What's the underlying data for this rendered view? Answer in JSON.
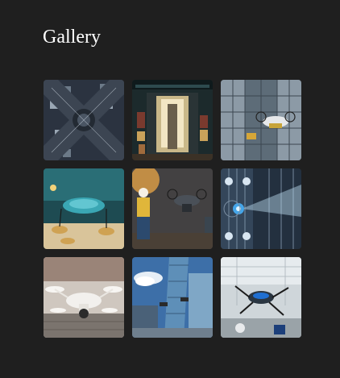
{
  "header": {
    "title": "Gallery"
  },
  "gallery": {
    "images": [
      {
        "subject": "aerial-city-intersection"
      },
      {
        "subject": "storefront-corridor"
      },
      {
        "subject": "drone-building-facade"
      },
      {
        "subject": "drone-teal-workshop"
      },
      {
        "subject": "worker-with-drone"
      },
      {
        "subject": "drone-spraying-glass-tower"
      },
      {
        "subject": "white-quadcopter-closeup"
      },
      {
        "subject": "skyscraper-drone-cityscape"
      },
      {
        "subject": "drone-robotic-lab"
      }
    ]
  }
}
